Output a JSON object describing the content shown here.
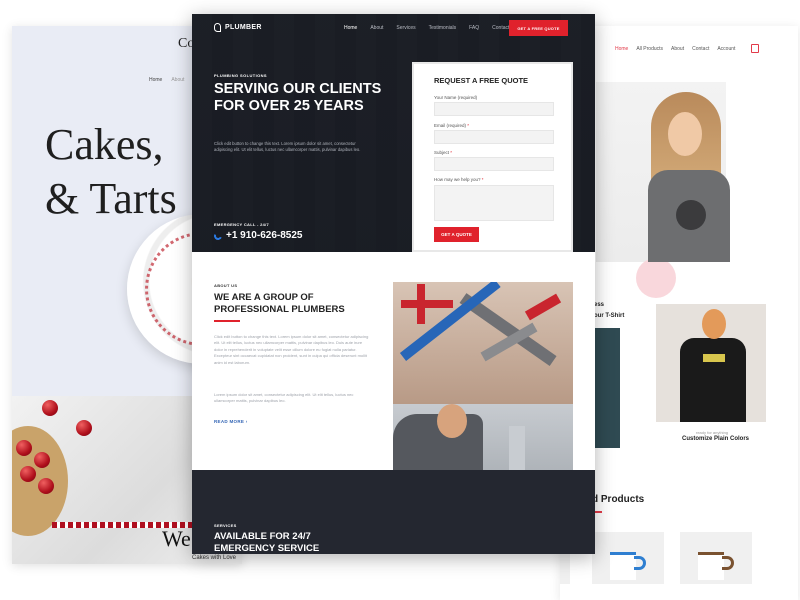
{
  "cakes": {
    "logo": "Co",
    "nav": [
      "Home",
      "About"
    ],
    "title": "Cakes, \n& Tarts",
    "footer_text": "We",
    "caption": "Cakes with Love"
  },
  "plumber": {
    "brand": "PLUMBER",
    "nav": [
      "Home",
      "About",
      "Services",
      "Testimonials",
      "FAQ",
      "Contact"
    ],
    "quote_button": "GET A FREE QUOTE",
    "hero": {
      "eyebrow": "PLUMBING SOLUTIONS",
      "title": "SERVING OUR CLIENTS FOR OVER 25 YEARS",
      "text": "Click edit button to change this text. Lorem ipsum dolor sit amet, consectetur adipiscing elit. Ut elit tellus, luctus nec ullamcorper mattis, pulvinar dapibus leo.",
      "emergency_label": "EMERGENCY CALL - 24/7",
      "phone": "+1 910-626-8525"
    },
    "form": {
      "title": "REQUEST A FREE QUOTE",
      "name_label": "Your Name (required)",
      "email_label": "Email (required)",
      "subject_label": "Subject",
      "message_label": "How may we help you?",
      "required_mark": "*",
      "submit": "GET A QUOTE"
    },
    "about": {
      "eyebrow": "ABOUT US",
      "title": "WE ARE A GROUP OF PROFESSIONAL PLUMBERS",
      "p1": "Click edit button to change this text. Lorem ipsum dolor sit amet, consectetur adipiscing elit. Ut elit tellus, luctus nec ullamcorper mattis, pulvinar dapibus leo. Duis aute irure dolor in reprehenderit in voluptate velit esse cillum dolore eu fugiat nulla pariatur. Excepteur sint occaecat cupidatat non proident, sunt in culpa qui officia deserunt mollit anim id est laborum.",
      "p2": "Lorem ipsum dolor sit amet, consectetur adipiscing elit. Ut elit tellus, luctus nec ullamcorper mattis, pulvinar dapibus leo.",
      "read_more": "READ MORE"
    },
    "services": {
      "eyebrow": "SERVICES",
      "title": "AVAILABLE FOR 24/7 EMERGENCY SERVICE"
    }
  },
  "shop": {
    "nav": [
      "Home",
      "All Products",
      "About",
      "Contact",
      "Account"
    ],
    "row_label_1": "ess",
    "row_label_2": "our T-Shirt",
    "product_caption_small": "ready for anything",
    "product_caption": "Customize Plain Colors",
    "featured_title": "d Products"
  },
  "colors": {
    "accent_red": "#e0222c",
    "dark_bg": "#242730",
    "link_blue": "#3466b5",
    "shop_accent": "#e23b4a"
  }
}
